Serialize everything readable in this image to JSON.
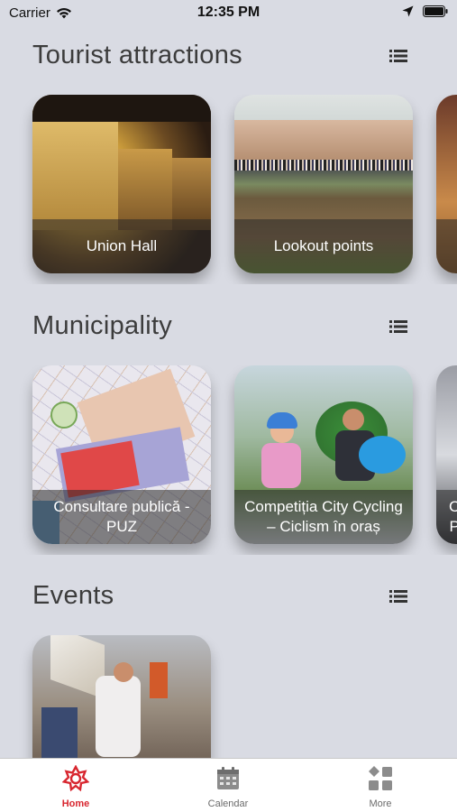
{
  "status": {
    "carrier": "Carrier",
    "time": "12:35 PM"
  },
  "sections": [
    {
      "title": "Tourist attractions",
      "cards": [
        {
          "label": "Union Hall"
        },
        {
          "label": "Lookout points"
        },
        {
          "label": ""
        }
      ]
    },
    {
      "title": "Municipality",
      "cards": [
        {
          "label": "Consultare publică - PUZ"
        },
        {
          "label": "Competiția City Cycling – Ciclism în oraș"
        },
        {
          "label": "C\nP"
        }
      ]
    },
    {
      "title": "Events",
      "cards": [
        {
          "label": ""
        }
      ]
    }
  ],
  "tabs": [
    {
      "label": "Home"
    },
    {
      "label": "Calendar"
    },
    {
      "label": "More"
    }
  ],
  "colors": {
    "background": "#d9dbe3",
    "accent": "#d8262f",
    "tab_inactive": "#6b6b6b"
  }
}
